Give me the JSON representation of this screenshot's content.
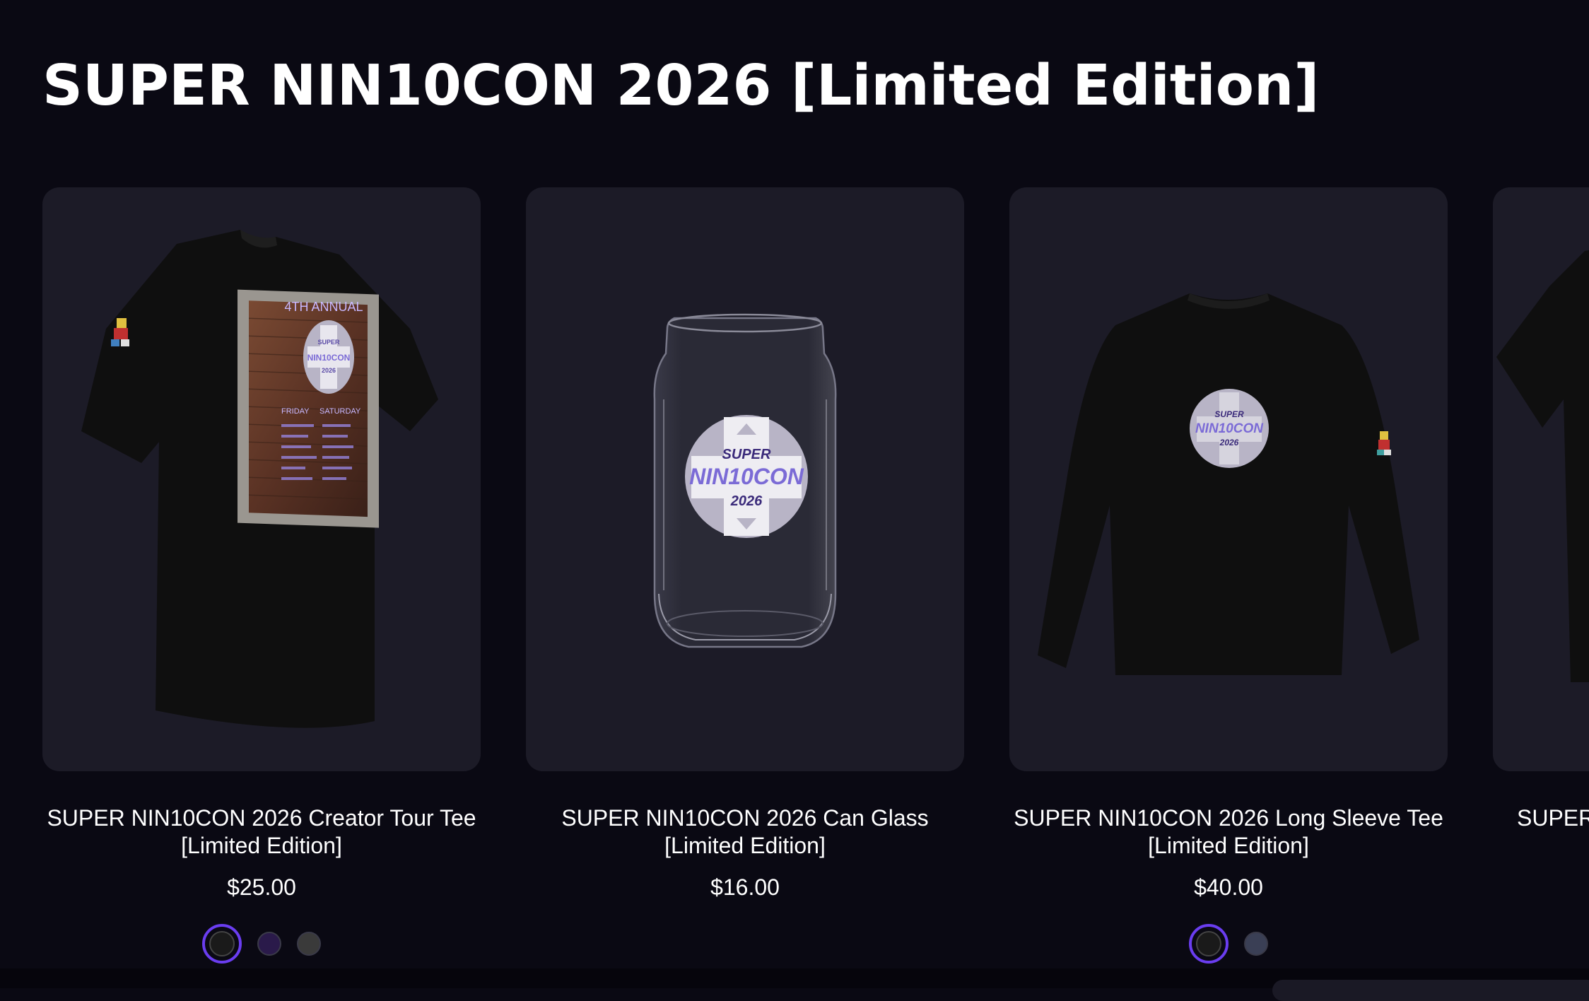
{
  "collection": {
    "title": "SUPER NIN10CON 2026 [Limited Edition]"
  },
  "products": [
    {
      "title_line1": "SUPER NIN10CON 2026 Creator Tour Tee",
      "title_line2": "[Limited Edition]",
      "price": "$25.00",
      "image_icon": "tshirt-icon",
      "swatches": [
        {
          "color": "#1a1a1a",
          "selected": true
        },
        {
          "color": "#2a1a4a",
          "selected": false
        },
        {
          "color": "#3a3a3a",
          "selected": false
        }
      ],
      "print": {
        "top": "4TH ANNUAL",
        "logo_line1": "SUPER",
        "logo_line2": "NIN10CON",
        "logo_line3": "2026",
        "day1": "FRIDAY",
        "day2": "SATURDAY"
      }
    },
    {
      "title_line1": "SUPER NIN10CON 2026 Can Glass",
      "title_line2": "[Limited Edition]",
      "price": "$16.00",
      "image_icon": "glass-icon",
      "swatches": [],
      "print": {
        "logo_line1": "SUPER",
        "logo_line2": "NIN10CON",
        "logo_line3": "2026"
      }
    },
    {
      "title_line1": "SUPER NIN10CON 2026 Long Sleeve Tee",
      "title_line2": "[Limited Edition]",
      "price": "$40.00",
      "image_icon": "long-sleeve-icon",
      "swatches": [
        {
          "color": "#1a1a1a",
          "selected": true
        },
        {
          "color": "#3a3f55",
          "selected": false
        }
      ],
      "print": {
        "logo_line1": "SUPER",
        "logo_line2": "NIN10CON",
        "logo_line3": "2026"
      }
    }
  ],
  "partial_product": {
    "title": "SUPER"
  },
  "colors": {
    "background": "#0a0913",
    "card": "#1c1b27",
    "accent": "#6a3df0",
    "logo_purple": "#7b6bd6"
  }
}
